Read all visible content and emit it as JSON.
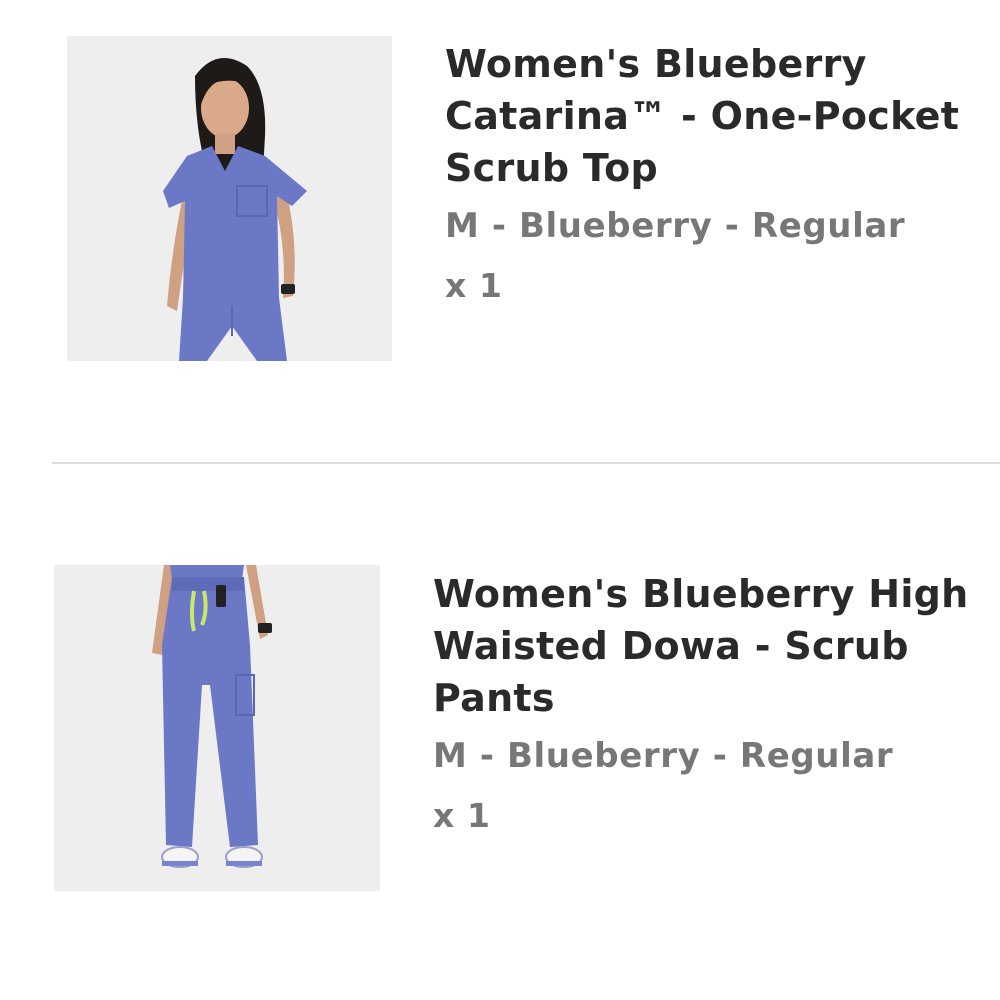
{
  "items": [
    {
      "title": "Women's Blueberry Catarina™ - One-Pocket Scrub Top",
      "variant": "M - Blueberry - Regular",
      "quantity": "x 1",
      "image_icon": "scrub-top-model-photo"
    },
    {
      "title": "Women's Blueberry High Waisted Dowa - Scrub Pants",
      "variant": "M - Blueberry - Regular",
      "quantity": "x 1",
      "image_icon": "scrub-pants-model-photo"
    }
  ],
  "colors": {
    "scrub": "#6b78c6",
    "image_background": "#eeeeee",
    "title_text": "#2a2a2a",
    "meta_text": "#777777",
    "divider": "#dcdcdc",
    "drawstring": "#c9e86a"
  }
}
